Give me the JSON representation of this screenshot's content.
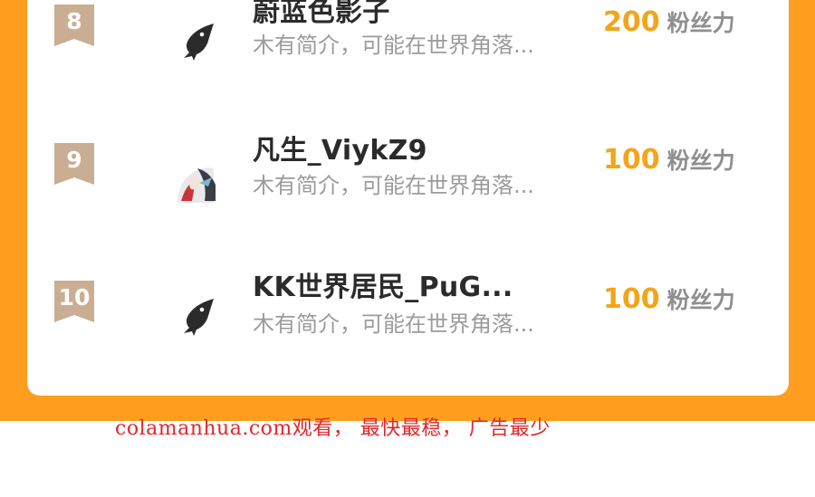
{
  "ranking": {
    "rows": [
      {
        "rank": "8",
        "name": "蔚蓝色影子",
        "intro": "木有简介，可能在世界角落...",
        "score": "200",
        "unit": "粉丝力",
        "avatar_icon": "fish-icon"
      },
      {
        "rank": "9",
        "name": "凡生_ViykZ9",
        "intro": "木有简介，可能在世界角落...",
        "score": "100",
        "unit": "粉丝力",
        "avatar_icon": "anime-avatar"
      },
      {
        "rank": "10",
        "name": "KK世界居民_PuG...",
        "intro": "木有简介，可能在世界角落...",
        "score": "100",
        "unit": "粉丝力",
        "avatar_icon": "fish-icon"
      }
    ]
  },
  "watermark": "colamanhua.com观看， 最快最稳， 广告最少",
  "colors": {
    "frame_orange": "#FF9E1E",
    "rank_flag": "#C9AE93",
    "score_gold": "#F2A51A",
    "watermark_red": "#E0272D"
  }
}
